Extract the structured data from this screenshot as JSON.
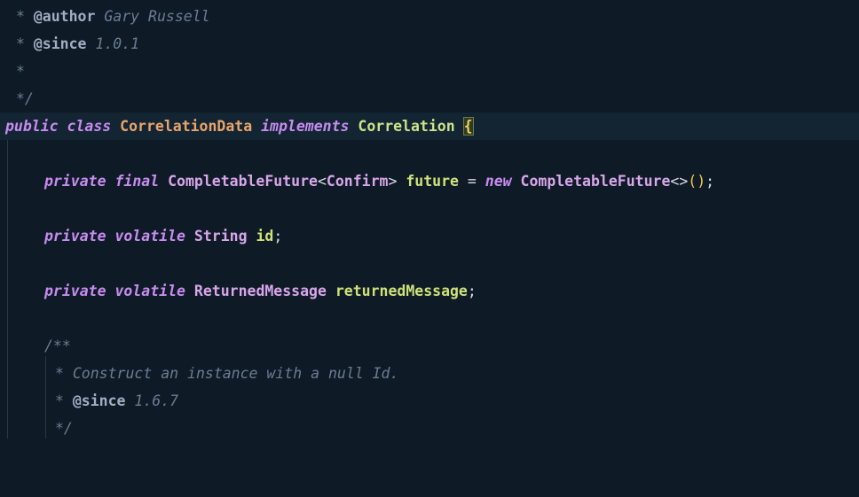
{
  "editor": {
    "lines": [
      {
        "star": "* ",
        "tag": "@author",
        "text": " Gary Russell"
      },
      {
        "star": "* ",
        "tag": "@since",
        "text": " 1.0.1"
      },
      {
        "star": "*"
      },
      {
        "star": "*/"
      },
      {
        "kw1": "public",
        "kw2": "class",
        "class_name": "CorrelationData",
        "kw3": "implements",
        "iface": "Correlation",
        "brace": "{"
      },
      {},
      {
        "kw1": "private",
        "kw2": "final",
        "type1": "CompletableFuture",
        "lt": "<",
        "type2": "Confirm",
        "gt": ">",
        "field": "future",
        "eq": "=",
        "kw3": "new",
        "type3": "CompletableFuture",
        "diamond": "<>",
        "parens": "()",
        "semi": ";"
      },
      {},
      {
        "kw1": "private",
        "kw2": "volatile",
        "type": "String",
        "field": "id",
        "semi": ";"
      },
      {},
      {
        "kw1": "private",
        "kw2": "volatile",
        "type": "ReturnedMessage",
        "field": "returnedMessage",
        "semi": ";"
      },
      {},
      {
        "star": "/**"
      },
      {
        "star": "* ",
        "text": "Construct an instance with a null Id."
      },
      {
        "star": "* ",
        "tag": "@since",
        "text": " 1.6.7"
      },
      {
        "star": "*/"
      }
    ]
  }
}
